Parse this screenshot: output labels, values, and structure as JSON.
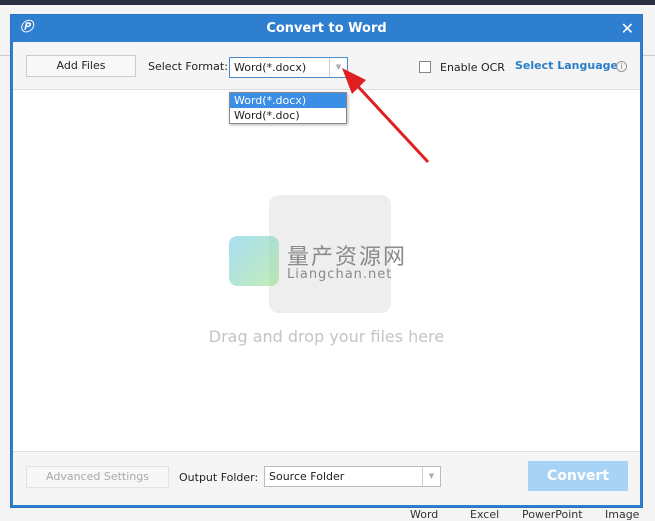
{
  "dialog": {
    "title": "Convert to Word",
    "close_icon": "close-icon",
    "logo_icon": "app-logo-icon"
  },
  "toolbar": {
    "add_files": "Add Files",
    "select_format_label": "Select Format:",
    "format_value": "Word(*.docx)",
    "format_options": [
      "Word(*.docx)",
      "Word(*.doc)"
    ],
    "enable_ocr": "Enable OCR",
    "ocr_checked": false,
    "select_language": "Select Language"
  },
  "dropzone": {
    "hint": "Drag and drop your files here",
    "watermark": "量产资源网",
    "watermark_sub": "Liangchan.net"
  },
  "footer": {
    "advanced_settings": "Advanced Settings",
    "output_folder_label": "Output Folder:",
    "output_folder_value": "Source Folder",
    "convert": "Convert"
  },
  "background_tabs": [
    "Word",
    "Excel",
    "PowerPoint",
    "Image"
  ],
  "colors": {
    "titlebar": "#2f7fd0",
    "link": "#2a7dc8",
    "convert_disabled": "#a9d3f5",
    "selected_option": "#3a8ee6",
    "arrow": "#e02020"
  }
}
